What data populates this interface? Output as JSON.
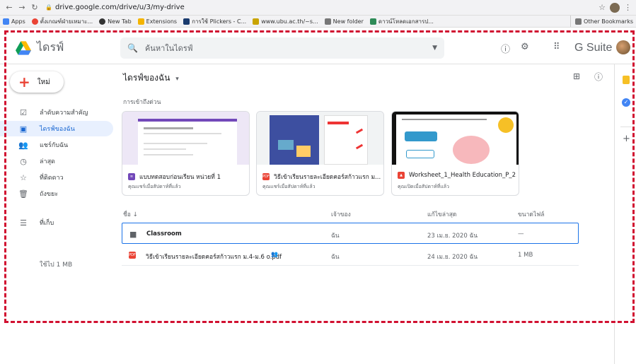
{
  "browser": {
    "url": "drive.google.com/drive/u/3/my-drive",
    "bookmarks": [
      {
        "label": "Apps",
        "color": "#4285f4"
      },
      {
        "label": "ตั้งเกณฑ์ฝ่ายเหมาะ...",
        "color": "#ea4335"
      },
      {
        "label": "New Tab",
        "color": "#333333"
      },
      {
        "label": "Extensions",
        "color": "#f4b400"
      },
      {
        "label": "การใช้ Plickers - C...",
        "color": "#1a3b6e"
      },
      {
        "label": "www.ubu.ac.th/~s...",
        "color": "#c9a400"
      },
      {
        "label": "New folder",
        "color": "#777777"
      },
      {
        "label": "ดาวน์โหลดเอกสารป...",
        "color": "#2e8b57"
      }
    ],
    "other_bookmarks": "Other Bookmarks"
  },
  "header": {
    "app_name": "ไดรฟ์",
    "search_placeholder": "ค้นหาในไดรฟ์",
    "gsuite": "G Suite"
  },
  "sidebar": {
    "new_label": "ใหม่",
    "items": [
      {
        "label": "ลำดับความสำคัญ",
        "icon": "priority-icon",
        "glyph": "☑"
      },
      {
        "label": "ไดรฟ์ของฉัน",
        "icon": "my-drive-icon",
        "glyph": "▣"
      },
      {
        "label": "แชร์กับฉัน",
        "icon": "shared-icon",
        "glyph": "👥"
      },
      {
        "label": "ล่าสุด",
        "icon": "clock-icon",
        "glyph": "🕓"
      },
      {
        "label": "ที่ติดดาว",
        "icon": "star-icon",
        "glyph": "☆"
      },
      {
        "label": "ถังขยะ",
        "icon": "trash-icon",
        "glyph": "🗑"
      },
      {
        "label": "ที่เก็บ",
        "icon": "storage-icon",
        "glyph": "☰"
      }
    ],
    "storage_used": "ใช้ไป 1 MB"
  },
  "main": {
    "title": "ไดรฟ์ของฉัน",
    "quick_access": "การเข้าถึงด่วน",
    "cards": [
      {
        "name": "แบบทดสอบก่อนเรียน หน่วยที่ 1",
        "sub": "คุณแชร์เมื่อสัปดาห์ที่แล้ว",
        "type": "form",
        "color": "#7248b9"
      },
      {
        "name": "วิธีเข้าเรียนรายละเอียดคอร์สก้าวแรก ม....",
        "sub": "คุณแชร์เมื่อสัปดาห์ที่แล้ว",
        "type": "pdf",
        "color": "#ea4335"
      },
      {
        "name": "Worksheet_1_Health Education_P_2...",
        "sub": "คุณเปิดเมื่อสัปดาห์ที่แล้ว",
        "type": "image",
        "color": "#ea4335"
      }
    ],
    "columns": {
      "name": "ชื่อ",
      "owner": "เจ้าของ",
      "modified": "แก้ไขล่าสุด",
      "size": "ขนาดไฟล์"
    },
    "files": [
      {
        "name": "Classroom",
        "owner": "ฉัน",
        "modified": "23 เม.ย. 2020 ฉัน",
        "size": "—",
        "type": "folder"
      },
      {
        "name": "วิธีเข้าเรียนรายละเอียดคอร์สก้าวแรก ม.4-ม.6 o.pdf",
        "owner": "ฉัน",
        "modified": "24 เม.ย. 2020 ฉัน",
        "size": "1 MB",
        "type": "pdf"
      }
    ]
  },
  "colors": {
    "accent": "#1a73e8",
    "annotation": "#d11030"
  }
}
